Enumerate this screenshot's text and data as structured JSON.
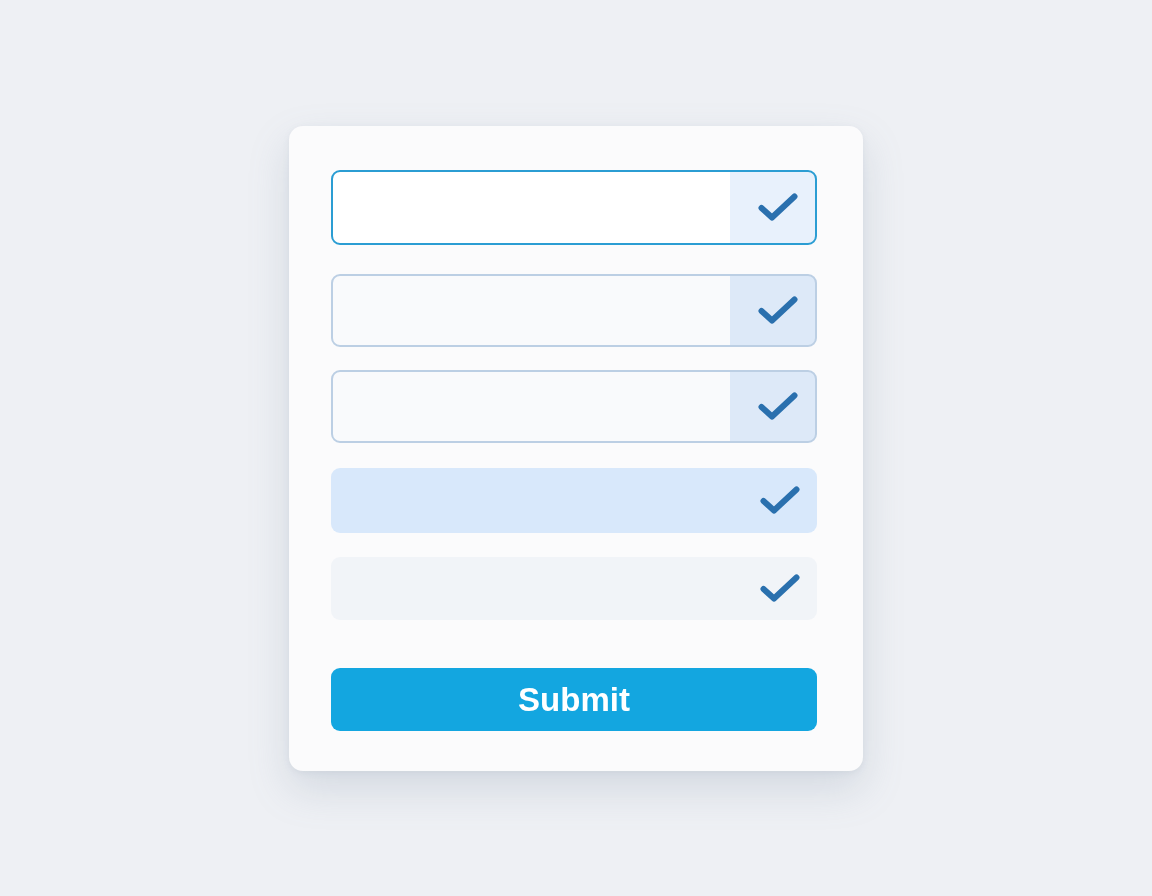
{
  "form": {
    "fields": [
      {
        "kind": "focused",
        "valid": true
      },
      {
        "kind": "outlined",
        "valid": true
      },
      {
        "kind": "outlined",
        "valid": true
      },
      {
        "kind": "filled",
        "valid": true
      },
      {
        "kind": "muted",
        "valid": true
      }
    ],
    "submit_button": {
      "label": "Submit"
    }
  }
}
